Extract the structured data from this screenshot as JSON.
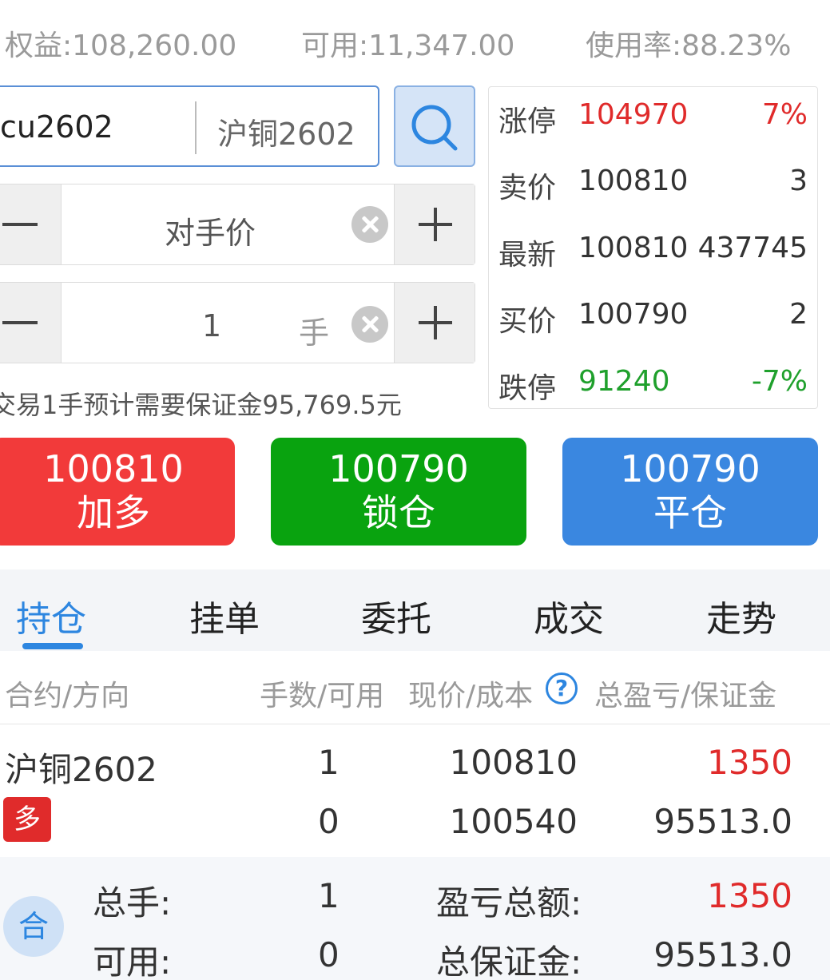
{
  "account": {
    "equity": "权益:108,260.00",
    "available": "可用:11,347.00",
    "usage": "使用率:88.23%"
  },
  "contract": {
    "code": "cu2602",
    "name": "沪铜2602"
  },
  "price_input": {
    "value": "对手价"
  },
  "quantity_input": {
    "value": "1",
    "unit": "手"
  },
  "margin_note": "交易1手预计需要保证金95,769.5元",
  "quote": {
    "limit_up": {
      "label": "涨停",
      "price": "104970",
      "extra": "7%"
    },
    "ask": {
      "label": "卖价",
      "price": "100810",
      "extra": "3"
    },
    "last": {
      "label": "最新",
      "price": "100810",
      "extra": "437745"
    },
    "bid": {
      "label": "买价",
      "price": "100790",
      "extra": "2"
    },
    "limit_down": {
      "label": "跌停",
      "price": "91240",
      "extra": "-7%"
    }
  },
  "actions": {
    "buy": {
      "price": "100810",
      "label": "加多",
      "color": "#f23a3a"
    },
    "lock": {
      "price": "100790",
      "label": "锁仓",
      "color": "#09a30f"
    },
    "close": {
      "price": "100790",
      "label": "平仓",
      "color": "#3a87e0"
    }
  },
  "tabs": [
    "持仓",
    "挂单",
    "委托",
    "成交",
    "走势"
  ],
  "active_tab": "持仓",
  "table": {
    "headers": {
      "contract": "合约/方向",
      "lots": "手数/可用",
      "price": "现价/成本",
      "pnl": "总盈亏/保证金"
    },
    "row": {
      "name": "沪铜2602",
      "direction": "多",
      "lots": "1",
      "available": "0",
      "current_price": "100810",
      "cost": "100540",
      "pnl": "1350",
      "margin": "95513.0"
    }
  },
  "summary": {
    "badge": "合",
    "total_lots_label": "总手:",
    "total_lots": "1",
    "available_label": "可用:",
    "available": "0",
    "pnl_label": "盈亏总额:",
    "pnl": "1350",
    "margin_label": "总保证金:",
    "margin": "95513.0"
  },
  "colors": {
    "accent": "#2d86e0",
    "up": "#e02b2b",
    "down": "#1fa02c"
  },
  "icons": [
    "search-icon",
    "clear-icon",
    "minus-icon",
    "plus-icon",
    "help-icon"
  ]
}
